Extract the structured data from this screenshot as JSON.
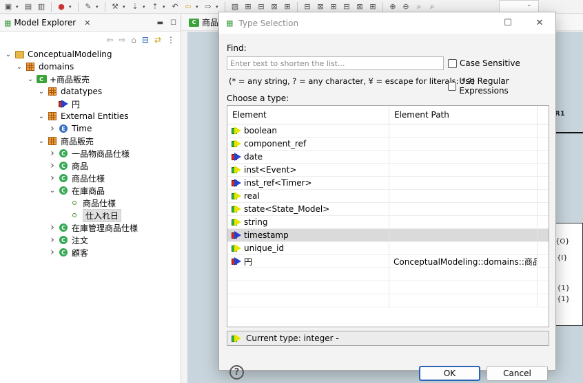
{
  "explorer": {
    "tab_label": "Model Explorer",
    "tree": [
      {
        "label": "ConceptualModeling",
        "icon": "folder-icon",
        "twist": "expanded",
        "level": 0
      },
      {
        "label": "domains",
        "icon": "package-icon",
        "twist": "expanded",
        "level": 1
      },
      {
        "label": "+商品販売",
        "icon": "component-icon",
        "twist": "expanded",
        "level": 2
      },
      {
        "label": "datatypes",
        "icon": "package-icon",
        "twist": "expanded",
        "level": 3
      },
      {
        "label": "円",
        "icon": "datatype-icon",
        "twist": "none",
        "level": 4
      },
      {
        "label": "External Entities",
        "icon": "package-icon",
        "twist": "expanded",
        "level": 3
      },
      {
        "label": "Time",
        "icon": "external-entity-icon",
        "twist": "collapsed",
        "level": 4
      },
      {
        "label": "商品販売",
        "icon": "package-icon",
        "twist": "expanded",
        "level": 3
      },
      {
        "label": "一品物商品仕様",
        "icon": "class-icon",
        "twist": "collapsed",
        "level": 4
      },
      {
        "label": "商品",
        "icon": "class-icon",
        "twist": "collapsed",
        "level": 4
      },
      {
        "label": "商品仕様",
        "icon": "class-icon",
        "twist": "collapsed",
        "level": 4
      },
      {
        "label": "在庫商品",
        "icon": "class-icon",
        "twist": "expanded",
        "level": 4
      },
      {
        "label": "商品仕様",
        "icon": "attribute-icon",
        "twist": "none",
        "level": 5
      },
      {
        "label": "仕入れ日",
        "icon": "attribute-icon",
        "twist": "none",
        "level": 5,
        "selected": true
      },
      {
        "label": "在庫管理商品仕様",
        "icon": "class-icon",
        "twist": "collapsed",
        "level": 4
      },
      {
        "label": "注文",
        "icon": "class-icon",
        "twist": "collapsed",
        "level": 4
      },
      {
        "label": "顧客",
        "icon": "class-icon",
        "twist": "collapsed",
        "level": 4
      }
    ]
  },
  "editor": {
    "tab_label": "商品",
    "canvas_texts": [
      "R1",
      "{O}",
      "{I}",
      "{1}",
      "{1}"
    ]
  },
  "dialog": {
    "title": "Type Selection",
    "find_label": "Find:",
    "find_placeholder": "Enter text to shorten the list...",
    "find_value": "",
    "case_sensitive_label": "Case Sensitive",
    "regex_label": "Use Regular Expressions",
    "hint": "(* = any string, ? = any character, ¥ = escape for literals: * ?)",
    "choose_label": "Choose a type:",
    "columns": [
      "Element",
      "Element Path"
    ],
    "rows": [
      {
        "element": "boolean",
        "path": "",
        "icon": "green"
      },
      {
        "element": "component_ref",
        "path": "",
        "icon": "green"
      },
      {
        "element": "date",
        "path": "",
        "icon": "red"
      },
      {
        "element": "inst<Event>",
        "path": "",
        "icon": "green"
      },
      {
        "element": "inst_ref<Timer>",
        "path": "",
        "icon": "red"
      },
      {
        "element": "real",
        "path": "",
        "icon": "green"
      },
      {
        "element": "state<State_Model>",
        "path": "",
        "icon": "green"
      },
      {
        "element": "string",
        "path": "",
        "icon": "green"
      },
      {
        "element": "timestamp",
        "path": "",
        "icon": "red",
        "selected": true
      },
      {
        "element": "unique_id",
        "path": "",
        "icon": "green"
      },
      {
        "element": "円",
        "path": "ConceptualModeling::domains::商品...",
        "icon": "red"
      }
    ],
    "current_type": "Current type: integer -",
    "ok_label": "OK",
    "cancel_label": "Cancel",
    "help_glyph": "?"
  }
}
